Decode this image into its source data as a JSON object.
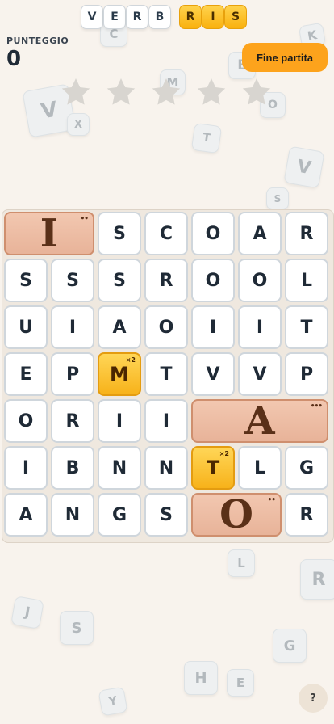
{
  "header": {
    "word_tiles": [
      "V",
      "E",
      "R",
      "B"
    ],
    "bonus_tiles": [
      "R",
      "I",
      "S"
    ]
  },
  "score": {
    "label": "PUNTEGGIO",
    "value": "0"
  },
  "end_button_label": "Fine partita",
  "help_label": "?",
  "stars": {
    "earned": 0,
    "total": 5
  },
  "background_letters": [
    "C",
    "K",
    "E",
    "M",
    "V",
    "X",
    "O",
    "T",
    "V",
    "S",
    "L",
    "R",
    "J",
    "S",
    "G",
    "H",
    "E",
    "Y"
  ],
  "board": {
    "columns": 7,
    "rows": 7,
    "tiles": [
      {
        "letter": "I",
        "r": 0,
        "c": 0,
        "w": 2,
        "kind": "big",
        "dots": "••"
      },
      {
        "letter": "S",
        "r": 0,
        "c": 2
      },
      {
        "letter": "C",
        "r": 0,
        "c": 3
      },
      {
        "letter": "O",
        "r": 0,
        "c": 4
      },
      {
        "letter": "A",
        "r": 0,
        "c": 5
      },
      {
        "letter": "R",
        "r": 0,
        "c": 6
      },
      {
        "letter": "S",
        "r": 1,
        "c": 0
      },
      {
        "letter": "S",
        "r": 1,
        "c": 1
      },
      {
        "letter": "S",
        "r": 1,
        "c": 2
      },
      {
        "letter": "R",
        "r": 1,
        "c": 3
      },
      {
        "letter": "O",
        "r": 1,
        "c": 4
      },
      {
        "letter": "O",
        "r": 1,
        "c": 5
      },
      {
        "letter": "L",
        "r": 1,
        "c": 6
      },
      {
        "letter": "U",
        "r": 2,
        "c": 0
      },
      {
        "letter": "I",
        "r": 2,
        "c": 1
      },
      {
        "letter": "A",
        "r": 2,
        "c": 2
      },
      {
        "letter": "O",
        "r": 2,
        "c": 3
      },
      {
        "letter": "I",
        "r": 2,
        "c": 4
      },
      {
        "letter": "I",
        "r": 2,
        "c": 5
      },
      {
        "letter": "T",
        "r": 2,
        "c": 6
      },
      {
        "letter": "E",
        "r": 3,
        "c": 0
      },
      {
        "letter": "P",
        "r": 3,
        "c": 1
      },
      {
        "letter": "M",
        "r": 3,
        "c": 2,
        "kind": "gold",
        "mult": "×2"
      },
      {
        "letter": "T",
        "r": 3,
        "c": 3
      },
      {
        "letter": "V",
        "r": 3,
        "c": 4
      },
      {
        "letter": "V",
        "r": 3,
        "c": 5
      },
      {
        "letter": "P",
        "r": 3,
        "c": 6
      },
      {
        "letter": "O",
        "r": 4,
        "c": 0
      },
      {
        "letter": "R",
        "r": 4,
        "c": 1
      },
      {
        "letter": "I",
        "r": 4,
        "c": 2
      },
      {
        "letter": "I",
        "r": 4,
        "c": 3
      },
      {
        "letter": "A",
        "r": 4,
        "c": 4,
        "w": 3,
        "kind": "big",
        "dots": "•••"
      },
      {
        "letter": "I",
        "r": 5,
        "c": 0
      },
      {
        "letter": "B",
        "r": 5,
        "c": 1
      },
      {
        "letter": "N",
        "r": 5,
        "c": 2
      },
      {
        "letter": "N",
        "r": 5,
        "c": 3
      },
      {
        "letter": "T",
        "r": 5,
        "c": 4,
        "kind": "gold",
        "mult": "×2"
      },
      {
        "letter": "L",
        "r": 5,
        "c": 5
      },
      {
        "letter": "G",
        "r": 5,
        "c": 6
      },
      {
        "letter": "A",
        "r": 6,
        "c": 0
      },
      {
        "letter": "N",
        "r": 6,
        "c": 1
      },
      {
        "letter": "G",
        "r": 6,
        "c": 2
      },
      {
        "letter": "S",
        "r": 6,
        "c": 3
      },
      {
        "letter": "O",
        "r": 6,
        "c": 4,
        "w": 2,
        "kind": "big",
        "dots": "••"
      },
      {
        "letter": "R",
        "r": 6,
        "c": 6
      }
    ]
  },
  "colors": {
    "accent": "#fda31c",
    "bonus_tile": "#f7b21a",
    "big_tile": "#e8b399",
    "star_empty": "#d8d5d0"
  }
}
